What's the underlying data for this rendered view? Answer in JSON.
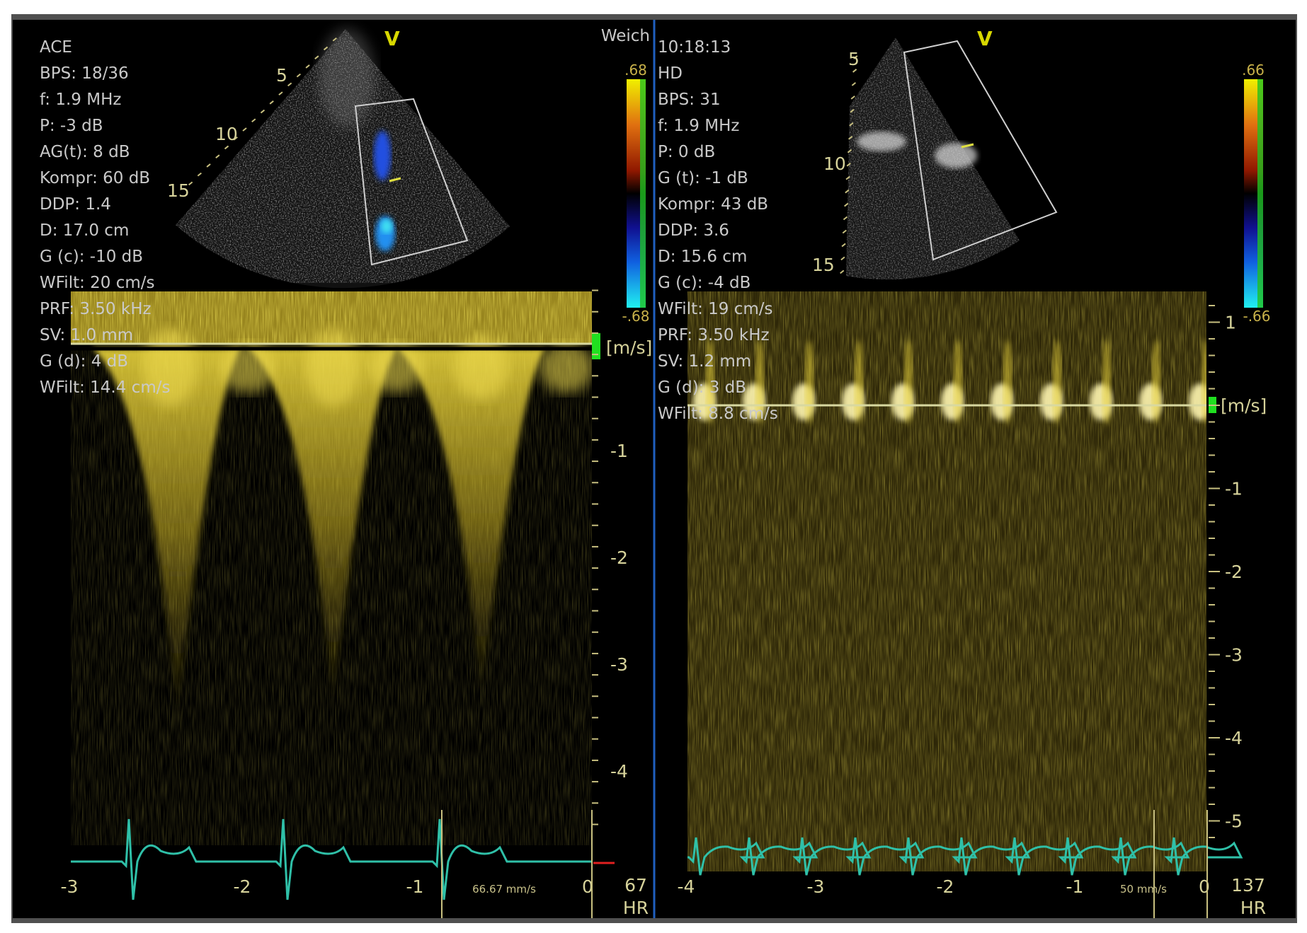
{
  "left_panel": {
    "params": [
      "ACE",
      "BPS: 18/36",
      "f: 1.9 MHz",
      "P: -3 dB",
      "AG(t):  8 dB",
      "Kompr: 60 dB",
      "DDP: 1.4",
      "D: 17.0 cm",
      "G (c): -10 dB",
      "WFilt: 20 cm/s",
      "PRF: 3.50 kHz",
      "SV: 1.0 mm",
      "G (d): 4 dB",
      "WFilt: 14.4 cm/s"
    ],
    "preset": "Weich",
    "colorbar": {
      "max": ".68",
      "min": "-.68"
    },
    "sector": {
      "marker": "V",
      "depths": [
        "5",
        "10",
        "15"
      ]
    },
    "velocity_unit": "[m/s]",
    "velocity_ticks": [
      "-1",
      "-2",
      "-3",
      "-4"
    ],
    "time_ticks": [
      "-3",
      "-2",
      "-1",
      "0"
    ],
    "sweep_speed": "66.67 mm/s",
    "hr_value": "67",
    "hr_label": "HR"
  },
  "right_panel": {
    "params": [
      "10:18:13",
      "HD",
      "BPS: 31",
      "f: 1.9 MHz",
      "P: 0 dB",
      "G (t): -1 dB",
      "Kompr: 43 dB",
      "DDP: 3.6",
      "D: 15.6 cm",
      "G (c): -4 dB",
      "WFilt: 19 cm/s",
      "PRF: 3.50 kHz",
      "SV: 1.2 mm",
      "G (d): 3 dB",
      "WFilt: 8.8 cm/s"
    ],
    "colorbar": {
      "max": ".66",
      "min": "-.66"
    },
    "sector": {
      "marker": "V",
      "depths": [
        "5",
        "10",
        "15"
      ]
    },
    "velocity_unit": "[m/s]",
    "velocity_ticks": [
      "1",
      "-1",
      "-2",
      "-3",
      "-4",
      "-5"
    ],
    "time_ticks": [
      "-4",
      "-3",
      "-2",
      "-1",
      "0"
    ],
    "sweep_speed": "50 mm/s",
    "hr_value": "137",
    "hr_label": "HR"
  },
  "colors": {
    "spectrum": "#e8d23a",
    "ecg": "#2fc0a8",
    "divider": "#1f5fbf",
    "scale_text": "#d6d29a"
  }
}
